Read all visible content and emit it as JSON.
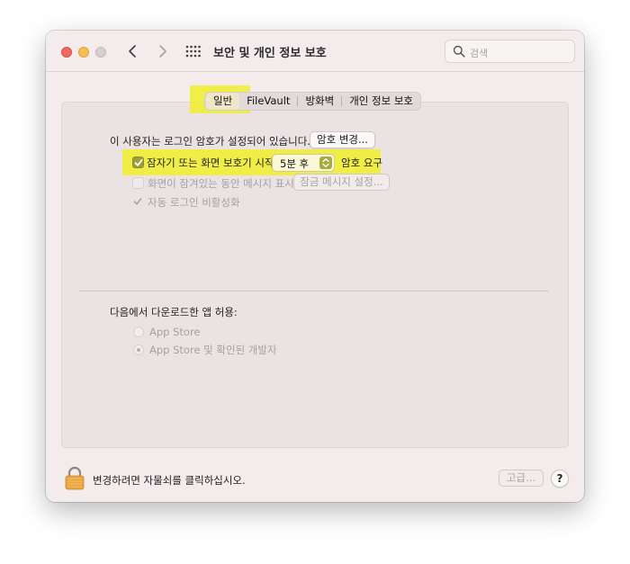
{
  "window": {
    "title": "보안 및 개인 정보 보호",
    "search_placeholder": "검색"
  },
  "tabs": [
    {
      "label": "일반",
      "selected": true
    },
    {
      "label": "FileVault",
      "selected": false
    },
    {
      "label": "방화벽",
      "selected": false
    },
    {
      "label": "개인 정보 보호",
      "selected": false
    }
  ],
  "general": {
    "password_set_text": "이 사용자는 로그인 암호가 설정되어 있습니다.",
    "change_password_button": "암호 변경...",
    "require_password_label": "잠자기 또는 화면 보호기 시작",
    "require_password_checked": true,
    "require_password_delay": "5분 후",
    "require_password_suffix": "암호 요구",
    "show_message_label": "화면이 잠겨있는 동안 메시지 표시",
    "show_message_checked": false,
    "set_lock_message_button": "잠금 메시지 설정...",
    "disable_autologin_label": "자동 로그인 비활성화",
    "disable_autologin_checked": true
  },
  "downloads": {
    "heading": "다음에서 다운로드한 앱 허용:",
    "options": [
      {
        "label": "App Store",
        "selected": false
      },
      {
        "label": "App Store 및 확인된 개발자",
        "selected": true
      }
    ]
  },
  "footer": {
    "lock_text": "변경하려면 자물쇠를 클릭하십시오.",
    "advanced_button": "고급...",
    "help_button": "?"
  },
  "colors": {
    "highlight": "#f0ef2a",
    "checkbox_accent": "#9da03a"
  }
}
